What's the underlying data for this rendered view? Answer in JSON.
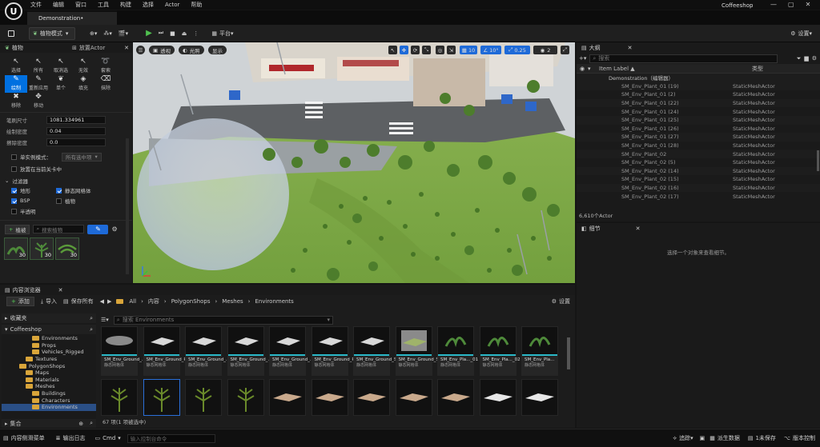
{
  "menu": [
    "文件",
    "编辑",
    "窗口",
    "工具",
    "构建",
    "选择",
    "Actor",
    "帮助"
  ],
  "project_name": "Coffeeshop",
  "doc_tab": "Demonstration•",
  "toolbar": {
    "mode": "植物模式",
    "platform": "平台",
    "settings": "设置"
  },
  "left": {
    "tabs": {
      "foliage": "植物",
      "place": "放置Actor"
    },
    "tools": [
      {
        "label": "选择",
        "icon": "arrow-icon"
      },
      {
        "label": "所有",
        "icon": "select-all-icon"
      },
      {
        "label": "取消选",
        "icon": "deselect-icon"
      },
      {
        "label": "无效",
        "icon": "invalid-icon"
      },
      {
        "label": "套索",
        "icon": "lasso-icon"
      },
      {
        "label": "绘制",
        "icon": "brush-icon"
      },
      {
        "label": "重新应用",
        "icon": "reapply-icon"
      },
      {
        "label": "单个",
        "icon": "single-icon"
      },
      {
        "label": "填充",
        "icon": "fill-icon"
      },
      {
        "label": "抹除",
        "icon": "erase-icon"
      },
      {
        "label": "移除",
        "icon": "remove-icon"
      },
      {
        "label": "移动",
        "icon": "move-icon"
      }
    ],
    "props": [
      {
        "label": "笔刷尺寸",
        "value": "1081.334961"
      },
      {
        "label": "绘制密度",
        "value": "0.04"
      },
      {
        "label": "擦除密度",
        "value": "0.0"
      }
    ],
    "single_instance": "单实例模式：",
    "single_dropdown": "所有选中项",
    "place_current": "放置在当前关卡中",
    "filter_header": "过滤器",
    "filters": [
      {
        "label": "地形",
        "on": true
      },
      {
        "label": "静态网格体",
        "on": true
      },
      {
        "label": "BSP",
        "on": true
      },
      {
        "label": "植物",
        "on": false
      },
      {
        "label": "半透明",
        "on": false
      }
    ],
    "add_foliage": "植被",
    "search_foliage": "搜索植物",
    "foliage_counts": [
      "30",
      "30",
      "30"
    ]
  },
  "viewport": {
    "perspective": "透视",
    "lit": "光照",
    "show": "显示",
    "grid": "10",
    "rot": "10°",
    "scale": "0.25",
    "cam": "2"
  },
  "outliner": {
    "title": "大纲",
    "search": "搜索",
    "col_label": "Item Label ▲",
    "col_type": "类型",
    "root": "Demonstration（编辑器）",
    "rows": [
      {
        "n": "SM_Env_Plant_01 (19)",
        "t": "StaticMeshActor"
      },
      {
        "n": "SM_Env_Plant_01 (2)",
        "t": "StaticMeshActor"
      },
      {
        "n": "SM_Env_Plant_01 (22)",
        "t": "StaticMeshActor"
      },
      {
        "n": "SM_Env_Plant_01 (24)",
        "t": "StaticMeshActor"
      },
      {
        "n": "SM_Env_Plant_01 (25)",
        "t": "StaticMeshActor"
      },
      {
        "n": "SM_Env_Plant_01 (26)",
        "t": "StaticMeshActor"
      },
      {
        "n": "SM_Env_Plant_01 (27)",
        "t": "StaticMeshActor"
      },
      {
        "n": "SM_Env_Plant_01 (28)",
        "t": "StaticMeshActor"
      },
      {
        "n": "SM_Env_Plant_02",
        "t": "StaticMeshActor"
      },
      {
        "n": "SM_Env_Plant_02 (5)",
        "t": "StaticMeshActor"
      },
      {
        "n": "SM_Env_Plant_02 (14)",
        "t": "StaticMeshActor"
      },
      {
        "n": "SM_Env_Plant_02 (15)",
        "t": "StaticMeshActor"
      },
      {
        "n": "SM_Env_Plant_02 (16)",
        "t": "StaticMeshActor"
      },
      {
        "n": "SM_Env_Plant_02 (17)",
        "t": "StaticMeshActor"
      }
    ],
    "count": "6,610个Actor"
  },
  "details": {
    "title": "细节",
    "empty": "选择一个对象来查看细节。"
  },
  "content": {
    "tab": "内容浏览器",
    "add": "添加",
    "import": "导入",
    "save_all": "保存所有",
    "path": [
      "All",
      "内容",
      "PolygonShops",
      "Meshes",
      "Environments"
    ],
    "settings": "设置",
    "favorites": "收藏夹",
    "project": "Coffeeshop",
    "tree": [
      "Environments",
      "Props",
      "Vehicles_Rigged",
      "Textures",
      "PolygonShops",
      "Maps",
      "Materials",
      "Meshes",
      "Buildings",
      "Characters",
      "Environments"
    ],
    "collections": "集合",
    "search": "搜索 Environments",
    "assets_row1": [
      {
        "n": "SM_Env_Ground_...",
        "ty": "静态网格体"
      },
      {
        "n": "SM_Env_Ground_Pan...",
        "ty": "静态网格体"
      },
      {
        "n": "SM_Env_Ground_...",
        "ty": "静态网格体"
      },
      {
        "n": "SM_Env_Ground_...",
        "ty": "静态网格体"
      },
      {
        "n": "SM_Env_Ground_...",
        "ty": "静态网格体"
      },
      {
        "n": "SM_Env_Ground_Pat...",
        "ty": "静态网格体"
      },
      {
        "n": "SM_Env_Ground_Sm...",
        "ty": "静态网格体"
      },
      {
        "n": "SM_Env_Ground_Sm...",
        "ty": "静态网格体"
      },
      {
        "n": "SM_Env_Pla..._01",
        "ty": "静态网格体"
      },
      {
        "n": "SM_Env_Pla..._02",
        "ty": "静态网格体"
      },
      {
        "n": "SM_Env_Pla...",
        "ty": "静态网格体"
      }
    ],
    "status": "67 项(1 项被选中)"
  },
  "status": {
    "drawer": "内容侧滑菜单",
    "log": "输出日志",
    "cmd": "Cmd",
    "cmd_placeholder": "输入控制台命令",
    "trace": "追踪",
    "derived": "派生数据",
    "unsaved": "1未保存",
    "source": "版本控制"
  }
}
